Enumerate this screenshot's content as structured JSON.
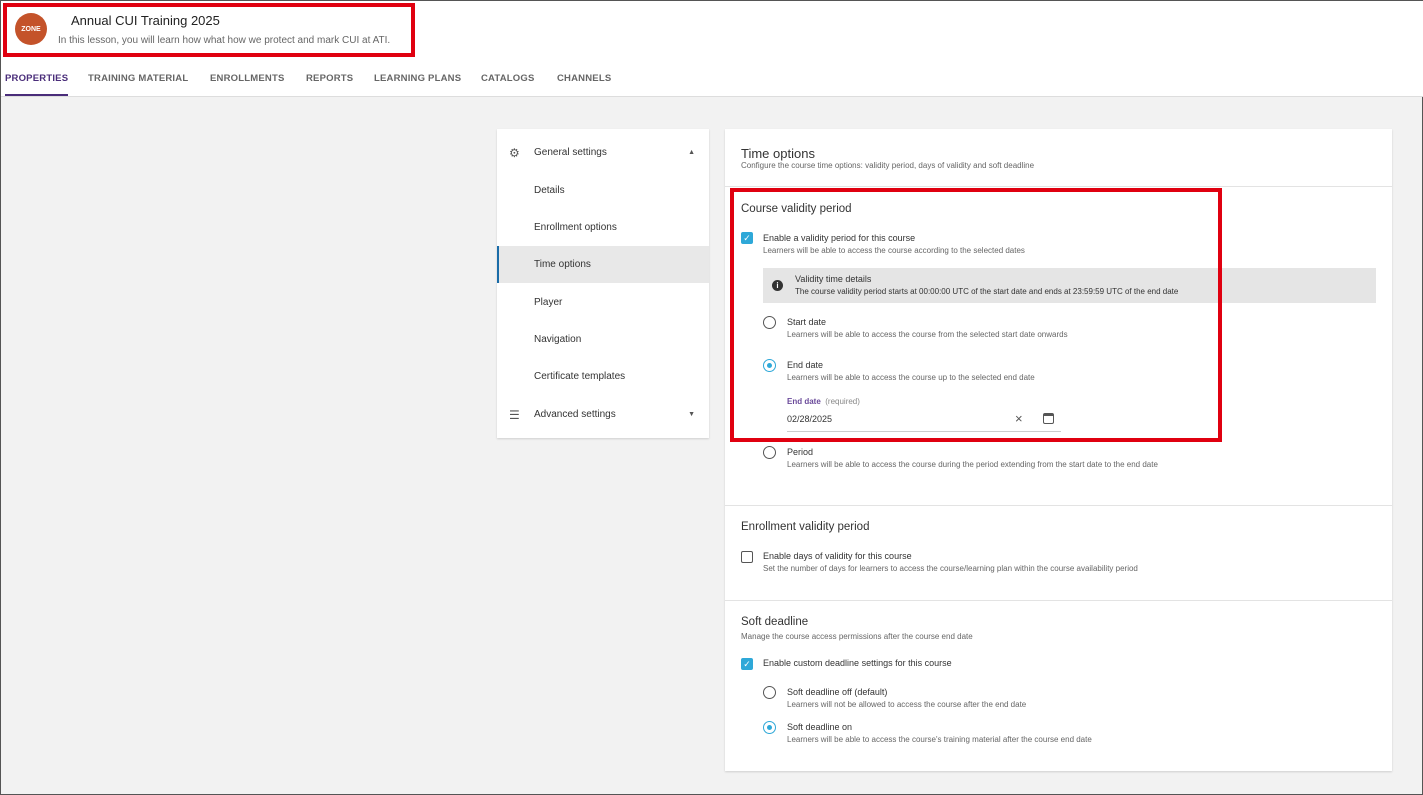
{
  "header": {
    "logo_text": "ZONE",
    "title": "Annual CUI Training 2025",
    "subtitle": "In this lesson, you will learn how what how we protect and mark CUI at ATI."
  },
  "tabs": [
    "PROPERTIES",
    "TRAINING MATERIAL",
    "ENROLLMENTS",
    "REPORTS",
    "LEARNING PLANS",
    "CATALOGS",
    "CHANNELS"
  ],
  "sidebar": {
    "general": "General settings",
    "items": [
      "Details",
      "Enrollment options",
      "Time options",
      "Player",
      "Navigation",
      "Certificate templates"
    ],
    "advanced": "Advanced settings"
  },
  "time_options": {
    "title": "Time options",
    "description": "Configure the course time options: validity period, days of validity and soft deadline"
  },
  "course_validity": {
    "title": "Course validity period",
    "enable_label": "Enable a validity period for this course",
    "enable_desc": "Learners will be able to access the course according to the selected dates",
    "info_title": "Validity time details",
    "info_text": "The course validity period starts at 00:00:00 UTC of the start date and ends at 23:59:59 UTC of the end date",
    "start_label": "Start date",
    "start_desc": "Learners will be able to access the course from the selected start date onwards",
    "end_label": "End date",
    "end_desc": "Learners will be able to access the course up to the selected end date",
    "field_label": "End date",
    "field_required": "(required)",
    "field_value": "02/28/2025",
    "period_label": "Period",
    "period_desc": "Learners will be able to access the course during the period extending from the start date to the end date"
  },
  "enrollment_validity": {
    "title": "Enrollment validity period",
    "enable_label": "Enable days of validity for this course",
    "enable_desc": "Set the number of days for learners to access the course/learning plan within the course availability period"
  },
  "soft_deadline": {
    "title": "Soft deadline",
    "description": "Manage the course access permissions after the course end date",
    "enable_label": "Enable custom deadline settings for this course",
    "off_label": "Soft deadline off (default)",
    "off_desc": "Learners will not be allowed to access the course after the end date",
    "on_label": "Soft deadline on",
    "on_desc": "Learners will be able to access the course's training material after the course end date"
  },
  "colors": {
    "accent": "#2ea8d8",
    "tab_active": "#4a2d7a",
    "highlight": "#e00010"
  }
}
